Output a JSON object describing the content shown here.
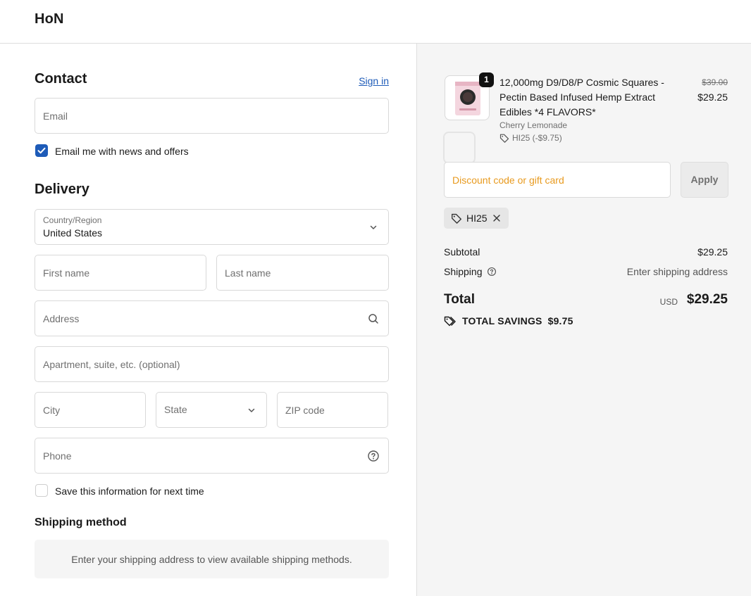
{
  "header": {
    "brand": "HoN"
  },
  "contact": {
    "title": "Contact",
    "sign_in": "Sign in",
    "email_placeholder": "Email",
    "newsletter_label": "Email me with news and offers",
    "newsletter_checked": true
  },
  "delivery": {
    "title": "Delivery",
    "country_label": "Country/Region",
    "country_value": "United States",
    "first_name": "First name",
    "last_name": "Last name",
    "address": "Address",
    "apartment": "Apartment, suite, etc. (optional)",
    "city": "City",
    "state": "State",
    "zip": "ZIP code",
    "phone": "Phone",
    "save_info_label": "Save this information for next time",
    "save_info_checked": false
  },
  "shipping_method": {
    "title": "Shipping method",
    "message": "Enter your shipping address to view available shipping methods."
  },
  "summary": {
    "item": {
      "quantity": "1",
      "name": "12,000mg D9/D8/P Cosmic Squares - Pectin Based Infused Hemp Extract Edibles *4 FLAVORS*",
      "variant": "Cherry Lemonade",
      "discount_tag": "HI25 (-$9.75)",
      "old_price": "$39.00",
      "price": "$29.25"
    },
    "discount_placeholder": "Discount code or gift card",
    "apply_label": "Apply",
    "applied_code": "HI25",
    "subtotal_label": "Subtotal",
    "subtotal_value": "$29.25",
    "shipping_label": "Shipping",
    "shipping_value": "Enter shipping address",
    "total_label": "Total",
    "currency": "USD",
    "total_value": "$29.25",
    "savings_label": "TOTAL SAVINGS",
    "savings_value": "$9.75"
  },
  "colors": {
    "accent": "#1e5bb8",
    "discount_placeholder": "#e89a1e",
    "summary_bg": "#f5f5f5"
  }
}
